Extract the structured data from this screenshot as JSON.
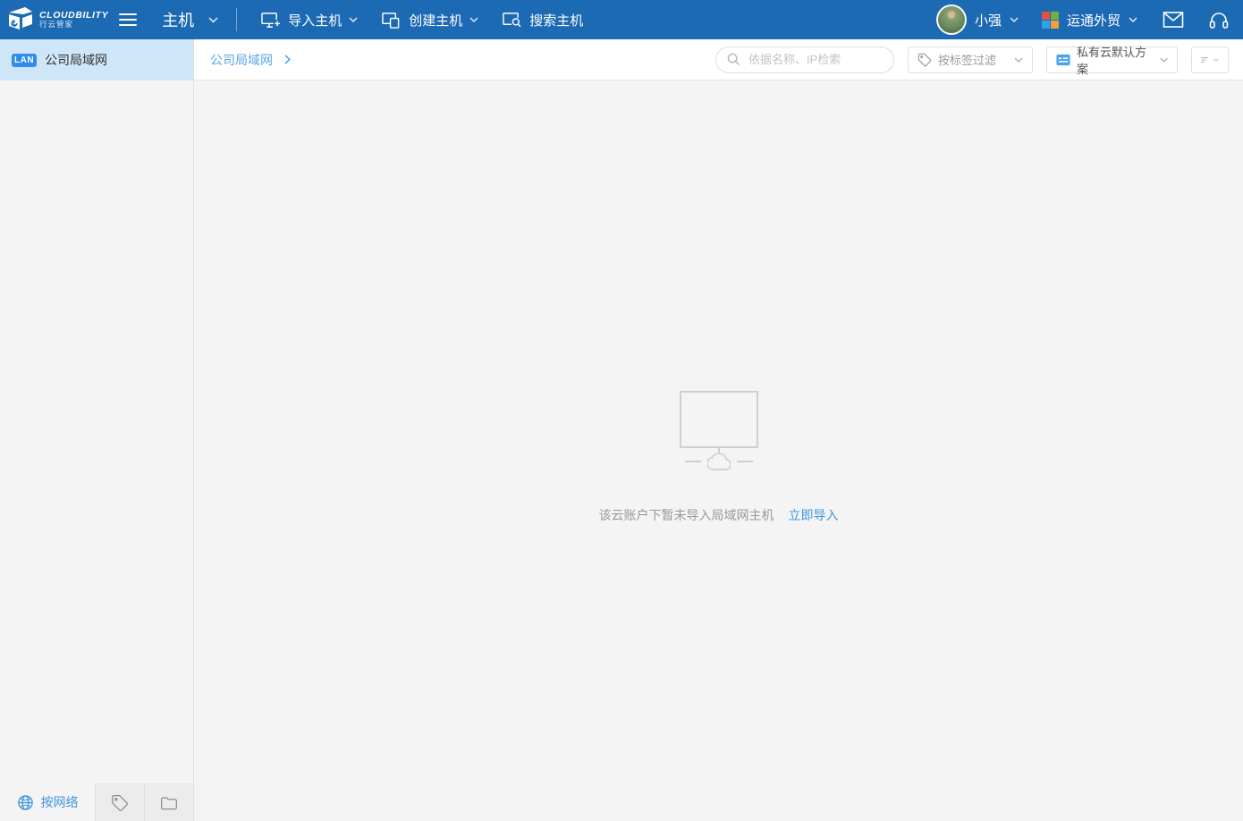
{
  "topbar": {
    "brand": {
      "name": "CLOUDBILITY",
      "subtitle": "行云管家"
    },
    "module": {
      "label": "主机"
    },
    "actions": [
      {
        "label": "导入主机",
        "icon": "import-host-icon",
        "has_dropdown": true
      },
      {
        "label": "创建主机",
        "icon": "create-host-icon",
        "has_dropdown": true
      },
      {
        "label": "搜索主机",
        "icon": "search-host-icon",
        "has_dropdown": false
      }
    ],
    "user": {
      "name": "小强"
    },
    "workspace": {
      "name": "运通外贸"
    }
  },
  "sidebar": {
    "selected": {
      "badge": "LAN",
      "label": "公司局域网"
    },
    "bottom": {
      "network_tab_label": "按网络"
    }
  },
  "toolbar": {
    "breadcrumb": "公司局域网",
    "search": {
      "placeholder": "依据名称、IP检索"
    },
    "tag_filter": {
      "label": "按标签过滤"
    },
    "scheme": {
      "label": "私有云默认方案"
    }
  },
  "content": {
    "empty_text": "该云账户下暂未导入局域网主机",
    "import_link": "立即导入"
  },
  "icons": {
    "logo": "cloudbility-logo",
    "menu_toggle": "hamburger",
    "import_host": "monitor-plus",
    "create_host": "monitor-copy",
    "search_host": "monitor-magnifier",
    "mail": "envelope",
    "support": "headset",
    "workspace_icon": "four-color-squares",
    "search": "magnifier",
    "tag_filter": "tag",
    "scheme": "card-list",
    "sort": "sort-lines",
    "network_tab": "globe",
    "tag_tab": "tag",
    "folder_tab": "folder",
    "empty_state": "monitor-cloud"
  },
  "colors": {
    "topbar_bg": "#1c69b4",
    "accent_blue": "#3e97e0",
    "breadcrumb_blue": "#58a5e6",
    "selected_item_bg": "#cfe5f8",
    "lan_badge_bg": "#2f8ce8",
    "empty_gray": "#cfcfcf",
    "workspace_squares": [
      "#e2504c",
      "#6fb13e",
      "#2ea3e8",
      "#f1a03c"
    ]
  }
}
